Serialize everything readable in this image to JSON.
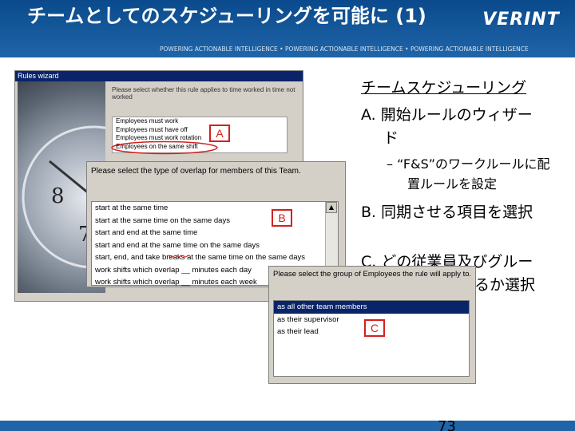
{
  "header": {
    "title": "チームとしてのスケジューリングを可能に (1)",
    "logo": "VERINT",
    "tagline": "POWERING ACTIONABLE INTELLIGENCE • POWERING ACTIONABLE INTELLIGENCE • POWERING ACTIONABLE INTELLIGENCE"
  },
  "wizard": {
    "title": "Rules wizard",
    "prompt": "Please select whether this rule applies to time worked in time not worked",
    "options": [
      "Employees must work",
      "Employees must have off",
      "Employees must work rotation",
      "Employees on the same shift"
    ],
    "badge": "A"
  },
  "overlap": {
    "prompt": "Please select the type of overlap for members of this Team.",
    "options": [
      "start at the same time",
      "start at the same time on the same days",
      "start and end at the same time",
      "start and end at the same time on the same days",
      "start, end, and take breaks at the same time on the same days",
      "work shifts which overlap __ minutes each day",
      "work shifts which overlap __ minutes each week"
    ],
    "badge": "B"
  },
  "group": {
    "prompt": "Please select the group of Employees the rule will apply to.",
    "options": [
      "as all other team members",
      "as their supervisor",
      "as their lead"
    ],
    "selected_index": 0,
    "badge": "C"
  },
  "outline": {
    "heading": "チームスケジューリング",
    "item_a": "A. 開始ルールのウィザード",
    "item_a_sub": "– “F&S”のワークルールに配置ルールを設定",
    "item_b": "B. 同期させる項目を選択",
    "item_c": "C. どの従業員及びグループを同期させるか選択"
  },
  "page_number": "73",
  "colors": {
    "header_blue": "#0a4a8c",
    "badge_red": "#d42020",
    "selection": "#0a246a"
  }
}
